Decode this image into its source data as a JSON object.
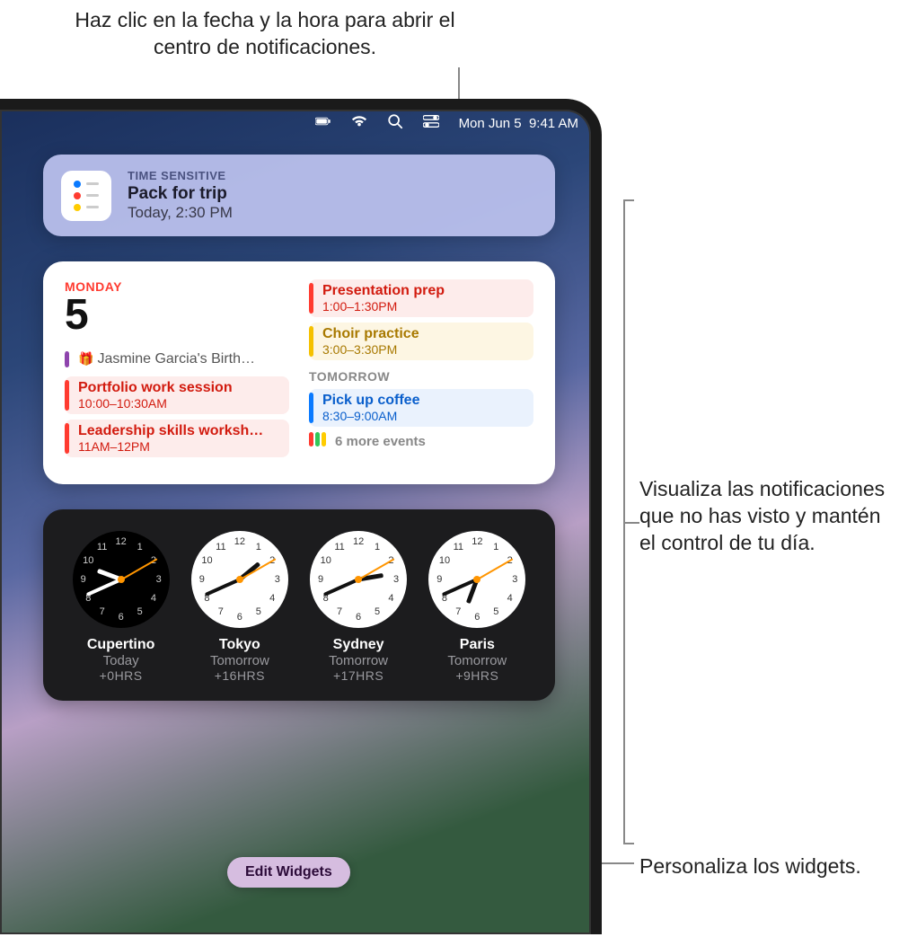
{
  "callouts": {
    "top": "Haz clic en la fecha y la hora para abrir el centro de notificaciones.",
    "middle": "Visualiza las notificaciones que no has visto y mantén el control de tu día.",
    "bottom": "Personaliza los widgets."
  },
  "menubar": {
    "date": "Mon Jun 5",
    "time": "9:41 AM"
  },
  "notification": {
    "tag": "TIME SENSITIVE",
    "title": "Pack for trip",
    "subtitle": "Today, 2:30 PM",
    "bullet_colors": [
      "#0a7aff",
      "#ff3b30",
      "#ffcc00"
    ]
  },
  "calendar": {
    "day_name": "MONDAY",
    "day_number": "5",
    "tomorrow_label": "TOMORROW",
    "more_label": "6 more events",
    "events_left": [
      {
        "title": "Jasmine Garcia's Birth…",
        "time": "",
        "color": "violet",
        "icon": "gift"
      },
      {
        "title": "Portfolio work session",
        "time": "10:00–10:30AM",
        "color": "red"
      },
      {
        "title": "Leadership skills worksh…",
        "time": "11AM–12PM",
        "color": "red"
      }
    ],
    "events_right_today": [
      {
        "title": "Presentation prep",
        "time": "1:00–1:30PM",
        "color": "red"
      },
      {
        "title": "Choir practice",
        "time": "3:00–3:30PM",
        "color": "yellow"
      }
    ],
    "events_right_tomorrow": [
      {
        "title": "Pick up coffee",
        "time": "8:30–9:00AM",
        "color": "blue"
      }
    ],
    "more_colors": [
      "#ff3b30",
      "#34c759",
      "#ffcc00"
    ]
  },
  "worldclock": [
    {
      "city": "Cupertino",
      "rel": "Today",
      "offset": "+0HRS",
      "face": "dark",
      "h": 9,
      "m": 41,
      "s": 10
    },
    {
      "city": "Tokyo",
      "rel": "Tomorrow",
      "offset": "+16HRS",
      "face": "light",
      "h": 1,
      "m": 41,
      "s": 10
    },
    {
      "city": "Sydney",
      "rel": "Tomorrow",
      "offset": "+17HRS",
      "face": "light",
      "h": 2,
      "m": 41,
      "s": 10
    },
    {
      "city": "Paris",
      "rel": "Tomorrow",
      "offset": "+9HRS",
      "face": "light",
      "h": 6,
      "m": 41,
      "s": 10
    }
  ],
  "edit_widgets_label": "Edit Widgets"
}
